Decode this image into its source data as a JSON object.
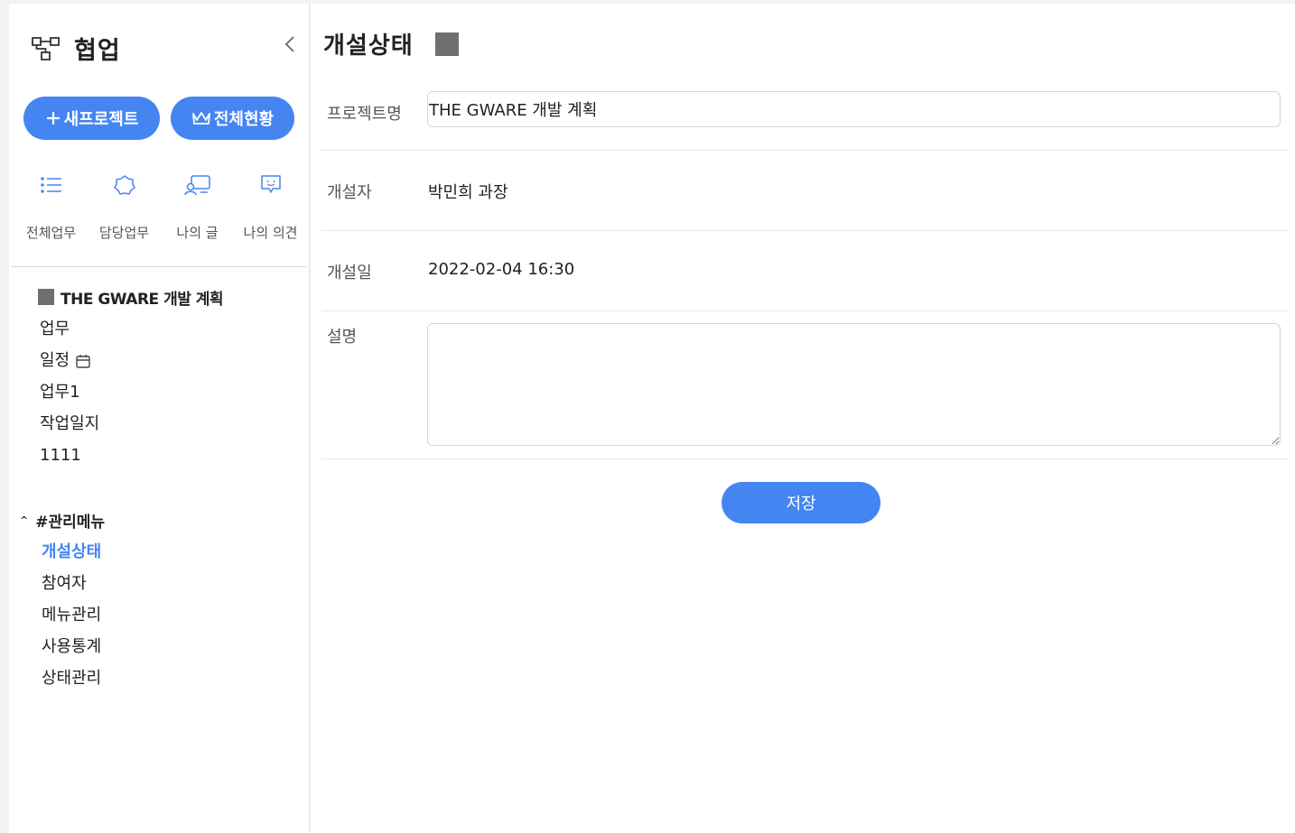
{
  "app": {
    "title": "협업",
    "logo_icon": "org-chart-icon",
    "collapse_icon": "chevron-left-icon"
  },
  "sidebar": {
    "buttons": {
      "new_project": {
        "label": "새프로젝트",
        "icon": "plus-icon"
      },
      "overview": {
        "label": "전체현황",
        "icon": "crown-icon"
      }
    },
    "quick_links": [
      {
        "label": "전체업무",
        "icon": "list-icon"
      },
      {
        "label": "담당업무",
        "icon": "badge-icon"
      },
      {
        "label": "나의 글",
        "icon": "user-post-icon"
      },
      {
        "label": "나의 의견",
        "icon": "comment-icon"
      }
    ],
    "project": {
      "name": "THE GWARE 개발 계획",
      "color": "#6f6f6f",
      "menus": [
        {
          "label": "업무"
        },
        {
          "label": "일정",
          "icon": "calendar-icon"
        },
        {
          "label": "업무1"
        },
        {
          "label": "작업일지"
        },
        {
          "label": "1111"
        }
      ]
    },
    "admin": {
      "title": "#관리메뉴",
      "caret": "^",
      "items": [
        {
          "label": "개설상태",
          "active": true
        },
        {
          "label": "참여자"
        },
        {
          "label": "메뉴관리"
        },
        {
          "label": "사용통계"
        },
        {
          "label": "상태관리"
        }
      ]
    }
  },
  "main": {
    "title": "개설상태",
    "status_color": "#6f6f6f",
    "form": {
      "project_name": {
        "label": "프로젝트명",
        "value": "THE GWARE 개발 계획"
      },
      "creator": {
        "label": "개설자",
        "value": "박민희 과장"
      },
      "created_date": {
        "label": "개설일",
        "value": "2022-02-04 16:30"
      },
      "description": {
        "label": "설명",
        "value": ""
      }
    },
    "save_label": "저장"
  },
  "colors": {
    "accent": "#4585f2",
    "status_square": "#6f6f6f"
  }
}
